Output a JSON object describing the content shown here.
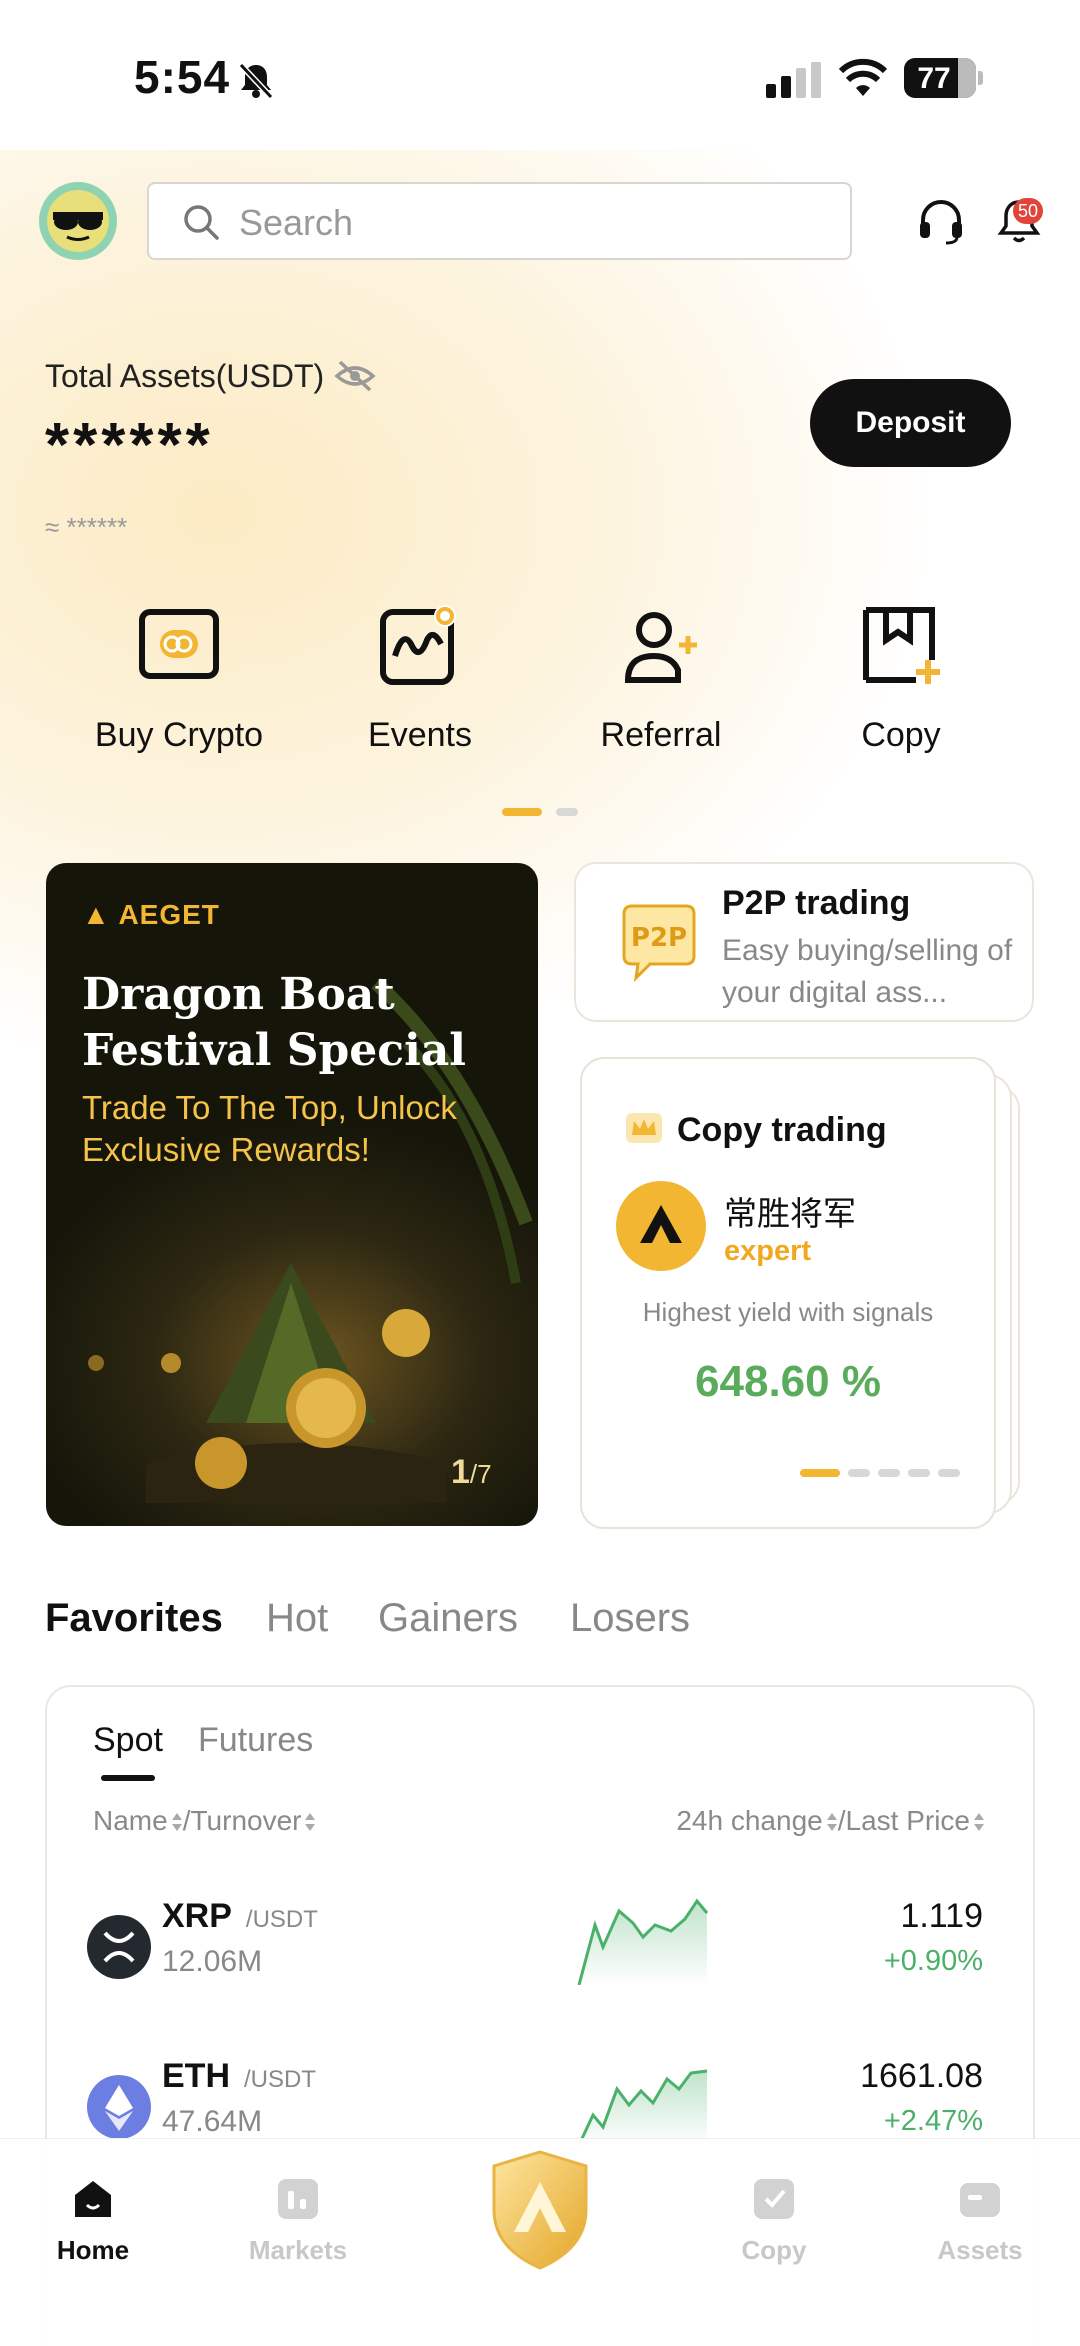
{
  "status": {
    "time": "5:54",
    "battery": "77"
  },
  "header": {
    "search_placeholder": "Search",
    "notification_count": "50"
  },
  "assets": {
    "label": "Total Assets(USDT)",
    "value": "******",
    "approx": "≈ ******",
    "deposit_label": "Deposit"
  },
  "quick_actions": [
    {
      "label": "Buy Crypto",
      "icon": "buy-crypto-icon"
    },
    {
      "label": "Events",
      "icon": "events-icon"
    },
    {
      "label": "Referral",
      "icon": "referral-icon"
    },
    {
      "label": "Copy",
      "icon": "copy-icon"
    }
  ],
  "banner": {
    "logo": "AEGET",
    "title": "Dragon Boat Festival Special",
    "subtitle": "Trade To The Top, Unlock Exclusive Rewards!",
    "current": "1",
    "total": "/7"
  },
  "p2p": {
    "badge": "P2P",
    "title": "P2P trading",
    "description": "Easy buying/selling of your digital ass..."
  },
  "copy_trading": {
    "title": "Copy trading",
    "trader_name": "常胜将军",
    "trader_level": "expert",
    "highlight": "Highest yield with signals",
    "yield": "648.60 %"
  },
  "category_tabs": [
    "Favorites",
    "Hot",
    "Gainers",
    "Losers"
  ],
  "market": {
    "sub_tabs": [
      "Spot",
      "Futures"
    ],
    "header_left_a": "Name",
    "header_left_b": "/Turnover",
    "header_right_a": "24h change",
    "header_right_b": "/Last Price",
    "rows": [
      {
        "symbol": "XRP",
        "quote": "/USDT",
        "volume": "12.06M",
        "price": "1.119",
        "change": "+0.90%"
      },
      {
        "symbol": "ETH",
        "quote": "/USDT",
        "volume": "47.64M",
        "price": "1661.08",
        "change": "+2.47%"
      }
    ]
  },
  "bottom_nav": [
    {
      "label": "Home",
      "icon": "home-icon"
    },
    {
      "label": "Markets",
      "icon": "markets-icon"
    },
    {
      "label": "Copy",
      "icon": "copy-icon"
    },
    {
      "label": "Assets",
      "icon": "assets-icon"
    }
  ],
  "colors": {
    "accent": "#f2b632",
    "positive": "#4bb06a",
    "dark": "#111111"
  }
}
